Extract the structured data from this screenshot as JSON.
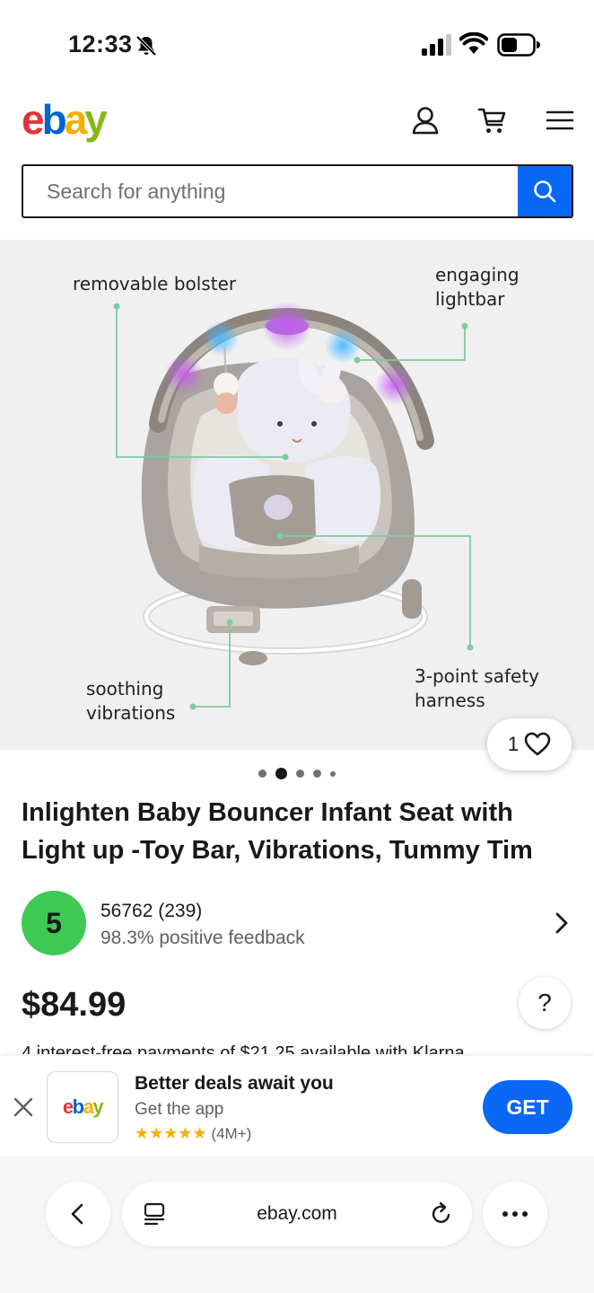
{
  "status_bar": {
    "time": "12:33"
  },
  "header": {
    "logo": {
      "e": "e",
      "b": "b",
      "a": "a",
      "y": "y"
    }
  },
  "search": {
    "placeholder": "Search for anything"
  },
  "hero": {
    "callouts": {
      "bolster": "removable bolster",
      "lightbar_1": "engaging",
      "lightbar_2": "lightbar",
      "vibrations_1": "soothing",
      "vibrations_2": "vibrations",
      "harness_1": "3-point safety",
      "harness_2": "harness"
    },
    "like_count": "1"
  },
  "product": {
    "title": "Inlighten Baby Bouncer Infant Seat with Light up -Toy Bar, Vibrations, Tummy Tim",
    "price": "$84.99",
    "klarna_text": "4 interest-free payments of $21.25 available with Klarna."
  },
  "seller": {
    "badge": "5",
    "name": "56762 (239)",
    "feedback": "98.3% positive feedback"
  },
  "help": {
    "label": "?"
  },
  "app_banner": {
    "icon_text": {
      "e": "e",
      "b": "b",
      "a": "a",
      "y": "y"
    },
    "title": "Better deals await you",
    "subtitle": "Get the app",
    "stars": "★★★★★",
    "rating_count": "(4M+)",
    "get_label": "GET"
  },
  "browser": {
    "url": "ebay.com"
  },
  "colors": {
    "ebay_red": "#e53238",
    "ebay_blue": "#0064d2",
    "ebay_yellow": "#f5af02",
    "ebay_green": "#86b817",
    "action_blue": "#0968f6",
    "seller_badge_green": "#3ec954"
  }
}
